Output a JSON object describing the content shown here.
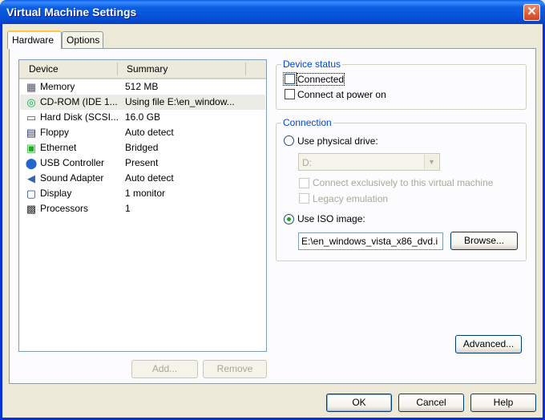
{
  "window": {
    "title": "Virtual Machine Settings",
    "close_glyph": "✕"
  },
  "tabs": [
    {
      "label": "Hardware"
    },
    {
      "label": "Options"
    }
  ],
  "device_list": {
    "headers": {
      "device": "Device",
      "summary": "Summary"
    },
    "rows": [
      {
        "icon": "memory-icon",
        "glyph": "▦",
        "device": "Memory",
        "summary": "512 MB"
      },
      {
        "icon": "cdrom-icon",
        "glyph": "◎",
        "device": "CD-ROM (IDE 1...",
        "summary": "Using file E:\\en_window..."
      },
      {
        "icon": "hard-disk-icon",
        "glyph": "▭",
        "device": "Hard Disk (SCSI...",
        "summary": "16.0 GB"
      },
      {
        "icon": "floppy-icon",
        "glyph": "▤",
        "device": "Floppy",
        "summary": "Auto detect"
      },
      {
        "icon": "ethernet-icon",
        "glyph": "▣",
        "device": "Ethernet",
        "summary": "Bridged"
      },
      {
        "icon": "usb-icon",
        "glyph": "⬤",
        "device": "USB Controller",
        "summary": "Present"
      },
      {
        "icon": "speaker-icon",
        "glyph": "◀",
        "device": "Sound Adapter",
        "summary": "Auto detect"
      },
      {
        "icon": "display-icon",
        "glyph": "▢",
        "device": "Display",
        "summary": "1 monitor"
      },
      {
        "icon": "processor-icon",
        "glyph": "▩",
        "device": "Processors",
        "summary": "1"
      }
    ],
    "selected_index": 1
  },
  "list_buttons": {
    "add": "Add...",
    "remove": "Remove"
  },
  "device_status": {
    "title": "Device status",
    "connected": {
      "label": "Connected",
      "checked": false
    },
    "connect_at_power_on": {
      "label": "Connect at power on",
      "checked": false
    }
  },
  "connection": {
    "title": "Connection",
    "use_physical_drive": {
      "label": "Use physical drive:",
      "selected": false
    },
    "drive_value": "D:",
    "connect_exclusively": {
      "label": "Connect exclusively to this virtual machine",
      "checked": false
    },
    "legacy_emulation": {
      "label": "Legacy emulation",
      "checked": false
    },
    "use_iso_image": {
      "label": "Use ISO image:",
      "selected": true
    },
    "iso_path": "E:\\en_windows_vista_x86_dvd.i",
    "browse": "Browse..."
  },
  "advanced": "Advanced...",
  "dialog_buttons": {
    "ok": "OK",
    "cancel": "Cancel",
    "help": "Help"
  }
}
